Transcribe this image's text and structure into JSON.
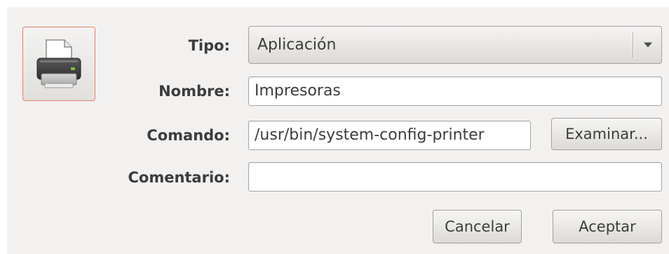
{
  "form": {
    "tipo_label": "Tipo:",
    "tipo_value": "Aplicación",
    "nombre_label": "Nombre:",
    "nombre_value": "Impresoras",
    "comando_label": "Comando:",
    "comando_value": "/usr/bin/system-config-printer",
    "comentario_label": "Comentario:",
    "comentario_value": ""
  },
  "buttons": {
    "browse": "Examinar...",
    "cancel": "Cancelar",
    "accept": "Aceptar"
  },
  "icons": {
    "launcher": "printer-icon",
    "dropdown": "chevron-down-icon"
  },
  "colors": {
    "icon_button_border": "#e0846a",
    "dialog_background": "#f2f1f0"
  }
}
